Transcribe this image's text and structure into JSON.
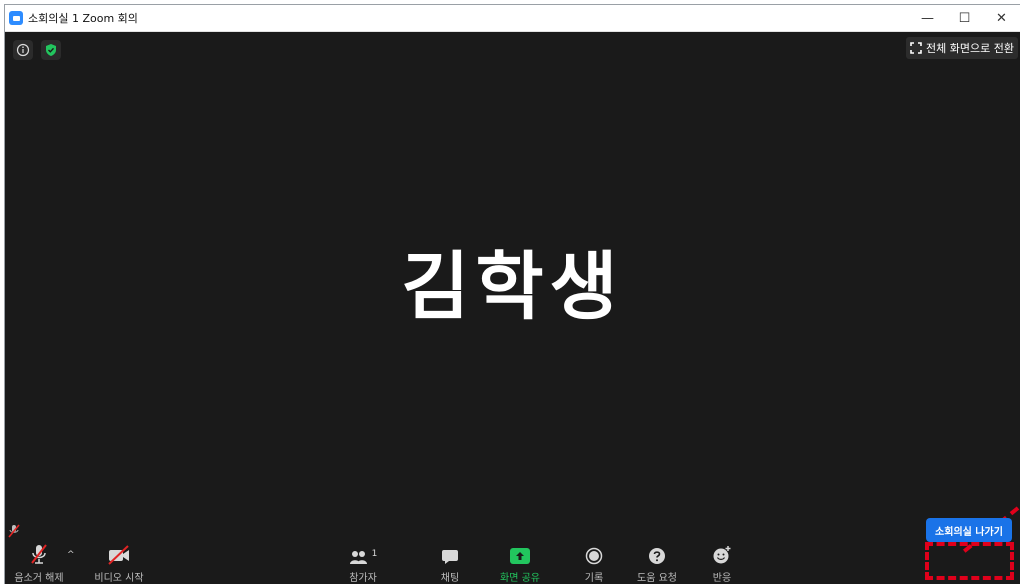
{
  "window": {
    "title": "소회의실 1   Zoom 회의",
    "controls": {
      "minimize": "—",
      "maximize": "☐",
      "close": "✕"
    }
  },
  "header": {
    "fullscreen_label": "전체 화면으로 전환"
  },
  "main": {
    "participant_name": "김학생"
  },
  "toolbar": {
    "unmute_label": "음소거 해제",
    "video_label": "비디오 시작",
    "participants_label": "참가자",
    "participants_count": "1",
    "chat_label": "채팅",
    "share_label": "화면 공유",
    "record_label": "기록",
    "help_label": "도움 요청",
    "reactions_label": "반응",
    "leave_label": "소회의실 나가기",
    "caret": "^"
  },
  "colors": {
    "background": "#1a1a1a",
    "accent": "#2d8cff",
    "share_green": "#22c55e",
    "leave_blue": "#1a73e8",
    "annotation_red": "#e0001b",
    "muted_red": "#e02424"
  }
}
